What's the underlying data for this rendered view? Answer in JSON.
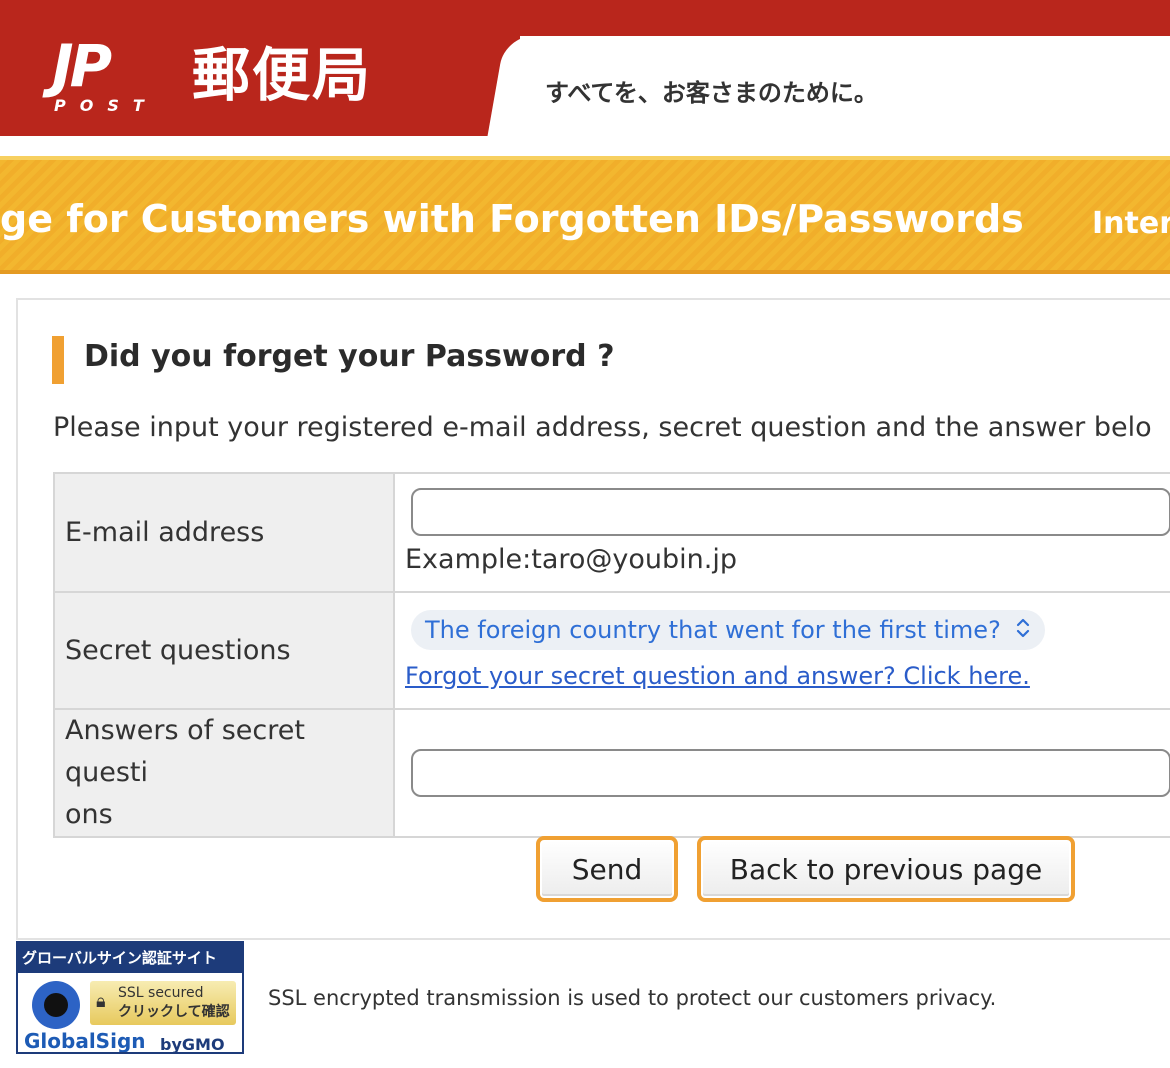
{
  "header": {
    "logo_mark": "JP",
    "logo_sub": "POST",
    "brand_name": "郵便局",
    "tagline": "すべてを、お客さまのために。",
    "brand_color": "#b9261c"
  },
  "band": {
    "title": "ge for Customers with Forgotten IDs/Passwords",
    "right_text": "Inter",
    "accent_color": "#f3b72f"
  },
  "section": {
    "title": "Did you forget your Password ?",
    "intro": "Please input your registered e-mail address, secret question and the answer belo"
  },
  "form": {
    "email": {
      "label": "E-mail address",
      "value": "",
      "example": "Example:taro@youbin.jp"
    },
    "question": {
      "label": "Secret questions",
      "selected": "The foreign country that went for the first time?",
      "forgot_link": "Forgot your secret question and answer? Click here."
    },
    "answer": {
      "label_line1": "Answers of secret questi",
      "label_line2": "ons",
      "value": ""
    }
  },
  "buttons": {
    "send": "Send",
    "back": "Back to previous page"
  },
  "ssl": {
    "badge_title": "グローバルサイン認証サイト",
    "badge_secured": "SSL secured",
    "badge_click": "クリックして確認",
    "badge_brand": "GlobalSign",
    "badge_by": "byGMO",
    "note": "SSL encrypted transmission is used to protect our customers privacy."
  }
}
